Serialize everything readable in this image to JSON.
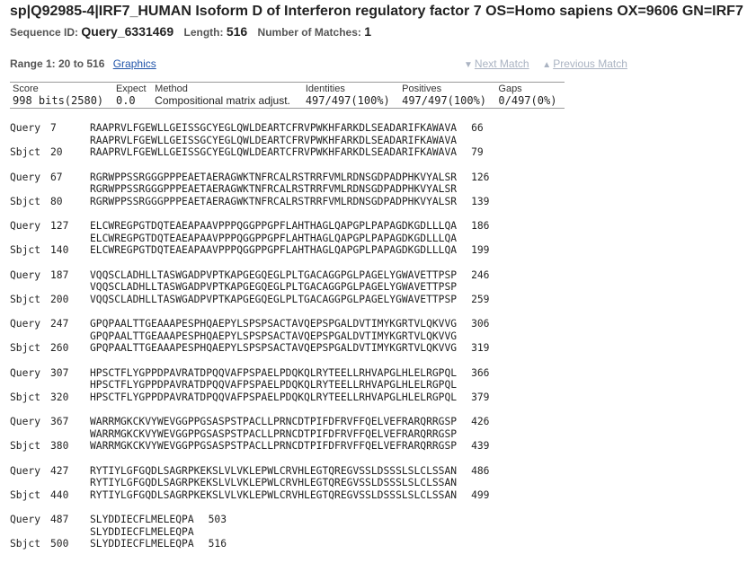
{
  "header": {
    "title": "sp|Q92985-4|IRF7_HUMAN Isoform D of Interferon regulatory factor 7 OS=Homo sapiens OX=9606 GN=IRF7",
    "sequence_id_label": "Sequence ID:",
    "sequence_id": "Query_6331469",
    "length_label": "Length:",
    "length": "516",
    "matches_label": "Number of Matches:",
    "matches": "1"
  },
  "range": {
    "label": "Range 1: 20 to 516",
    "graphics_link": "Graphics",
    "next_match": "Next Match",
    "previous_match": "Previous Match"
  },
  "stats": {
    "headers": [
      "Score",
      "Expect",
      "Method",
      "Identities",
      "Positives",
      "Gaps"
    ],
    "values": [
      "998 bits(2580)",
      "0.0",
      "Compositional matrix adjust.",
      "497/497(100%)",
      "497/497(100%)",
      "0/497(0%)"
    ]
  },
  "alignment": [
    {
      "q_start": "7",
      "q_seq": "RAAPRVLFGEWLLGEISSGCYEGLQWLDEARTCFRVPWKHFARKDLSEADARIFKAWAVA",
      "q_end": "66",
      "mid": "RAAPRVLFGEWLLGEISSGCYEGLQWLDEARTCFRVPWKHFARKDLSEADARIFKAWAVA",
      "s_start": "20",
      "s_seq": "RAAPRVLFGEWLLGEISSGCYEGLQWLDEARTCFRVPWKHFARKDLSEADARIFKAWAVA",
      "s_end": "79"
    },
    {
      "q_start": "67",
      "q_seq": "RGRWPPSSRGGGPPPEAETAERAGWKTNFRCALRSTRRFVMLRDNSGDPADPHKVYALSR",
      "q_end": "126",
      "mid": "RGRWPPSSRGGGPPPEAETAERAGWKTNFRCALRSTRRFVMLRDNSGDPADPHKVYALSR",
      "s_start": "80",
      "s_seq": "RGRWPPSSRGGGPPPEAETAERAGWKTNFRCALRSTRRFVMLRDNSGDPADPHKVYALSR",
      "s_end": "139"
    },
    {
      "q_start": "127",
      "q_seq": "ELCWREGPGTDQTEAEAPAAVPPPQGGPPGPFLAHTHAGLQAPGPLPAPAGDKGDLLLQA",
      "q_end": "186",
      "mid": "ELCWREGPGTDQTEAEAPAAVPPPQGGPPGPFLAHTHAGLQAPGPLPAPAGDKGDLLLQA",
      "s_start": "140",
      "s_seq": "ELCWREGPGTDQTEAEAPAAVPPPQGGPPGPFLAHTHAGLQAPGPLPAPAGDKGDLLLQA",
      "s_end": "199"
    },
    {
      "q_start": "187",
      "q_seq": "VQQSCLADHLLTASWGADPVPTKAPGEGQEGLPLTGACAGGPGLPAGELYGWAVETTPSP",
      "q_end": "246",
      "mid": "VQQSCLADHLLTASWGADPVPTKAPGEGQEGLPLTGACAGGPGLPAGELYGWAVETTPSP",
      "s_start": "200",
      "s_seq": "VQQSCLADHLLTASWGADPVPTKAPGEGQEGLPLTGACAGGPGLPAGELYGWAVETTPSP",
      "s_end": "259"
    },
    {
      "q_start": "247",
      "q_seq": "GPQPAALTTGEAAAPESPHQAEPYLSPSPSACTAVQEPSPGALDVTIMYKGRTVLQKVVG",
      "q_end": "306",
      "mid": "GPQPAALTTGEAAAPESPHQAEPYLSPSPSACTAVQEPSPGALDVTIMYKGRTVLQKVVG",
      "s_start": "260",
      "s_seq": "GPQPAALTTGEAAAPESPHQAEPYLSPSPSACTAVQEPSPGALDVTIMYKGRTVLQKVVG",
      "s_end": "319"
    },
    {
      "q_start": "307",
      "q_seq": "HPSCTFLYGPPDPAVRATDPQQVAFPSPAELPDQKQLRYTEELLRHVAPGLHLELRGPQL",
      "q_end": "366",
      "mid": "HPSCTFLYGPPDPAVRATDPQQVAFPSPAELPDQKQLRYTEELLRHVAPGLHLELRGPQL",
      "s_start": "320",
      "s_seq": "HPSCTFLYGPPDPAVRATDPQQVAFPSPAELPDQKQLRYTEELLRHVAPGLHLELRGPQL",
      "s_end": "379"
    },
    {
      "q_start": "367",
      "q_seq": "WARRMGKCKVYWEVGGPPGSASPSTPACLLPRNCDTPIFDFRVFFQELVEFRARQRRGSP",
      "q_end": "426",
      "mid": "WARRMGKCKVYWEVGGPPGSASPSTPACLLPRNCDTPIFDFRVFFQELVEFRARQRRGSP",
      "s_start": "380",
      "s_seq": "WARRMGKCKVYWEVGGPPGSASPSTPACLLPRNCDTPIFDFRVFFQELVEFRARQRRGSP",
      "s_end": "439"
    },
    {
      "q_start": "427",
      "q_seq": "RYTIYLGFGQDLSAGRPKEKSLVLVKLEPWLCRVHLEGTQREGVSSLDSSSLSLCLSSAN",
      "q_end": "486",
      "mid": "RYTIYLGFGQDLSAGRPKEKSLVLVKLEPWLCRVHLEGTQREGVSSLDSSSLSLCLSSAN",
      "s_start": "440",
      "s_seq": "RYTIYLGFGQDLSAGRPKEKSLVLVKLEPWLCRVHLEGTQREGVSSLDSSSLSLCLSSAN",
      "s_end": "499"
    },
    {
      "q_start": "487",
      "q_seq": "SLYDDIECFLMELEQPA",
      "q_end": "503",
      "mid": "SLYDDIECFLMELEQPA",
      "s_start": "500",
      "s_seq": "SLYDDIECFLMELEQPA",
      "s_end": "516"
    }
  ],
  "labels": {
    "query": "Query",
    "sbjct": "Sbjct"
  }
}
